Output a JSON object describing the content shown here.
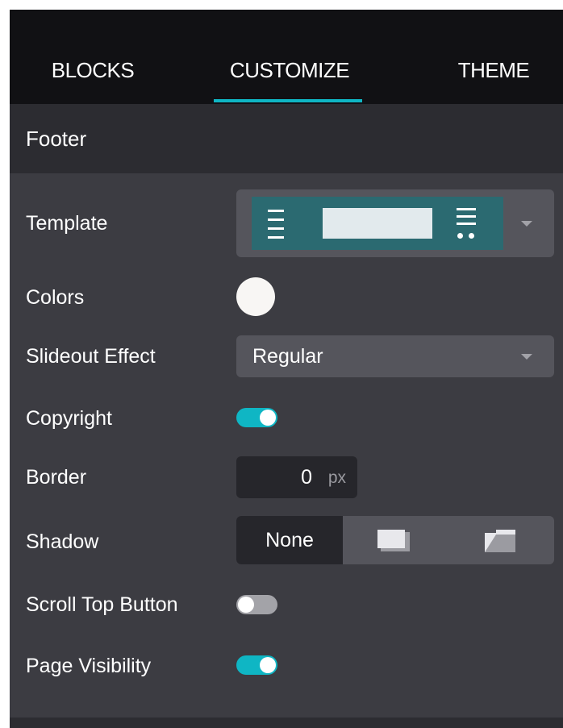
{
  "tabs": [
    {
      "label": "BLOCKS",
      "active": false
    },
    {
      "label": "CUSTOMIZE",
      "active": true
    },
    {
      "label": "THEME",
      "active": false
    }
  ],
  "section": {
    "title": "Footer"
  },
  "options": {
    "template": {
      "label": "Template"
    },
    "colors": {
      "label": "Colors",
      "value": "#f8f6f4"
    },
    "slideout": {
      "label": "Slideout Effect",
      "value": "Regular"
    },
    "copyright": {
      "label": "Copyright",
      "enabled": true
    },
    "border": {
      "label": "Border",
      "value": "0",
      "unit": "px"
    },
    "shadow": {
      "label": "Shadow",
      "selected": "None",
      "choices": [
        "None",
        "shadow-small-icon",
        "shadow-large-icon"
      ]
    },
    "scroll_top": {
      "label": "Scroll Top Button",
      "enabled": false
    },
    "page_visibility": {
      "label": "Page Visibility",
      "enabled": true
    }
  },
  "colors": {
    "accent": "#0fb6c4",
    "panel_bg": "#3c3c42",
    "header_bg": "#111114",
    "input_bg": "#55555c"
  }
}
